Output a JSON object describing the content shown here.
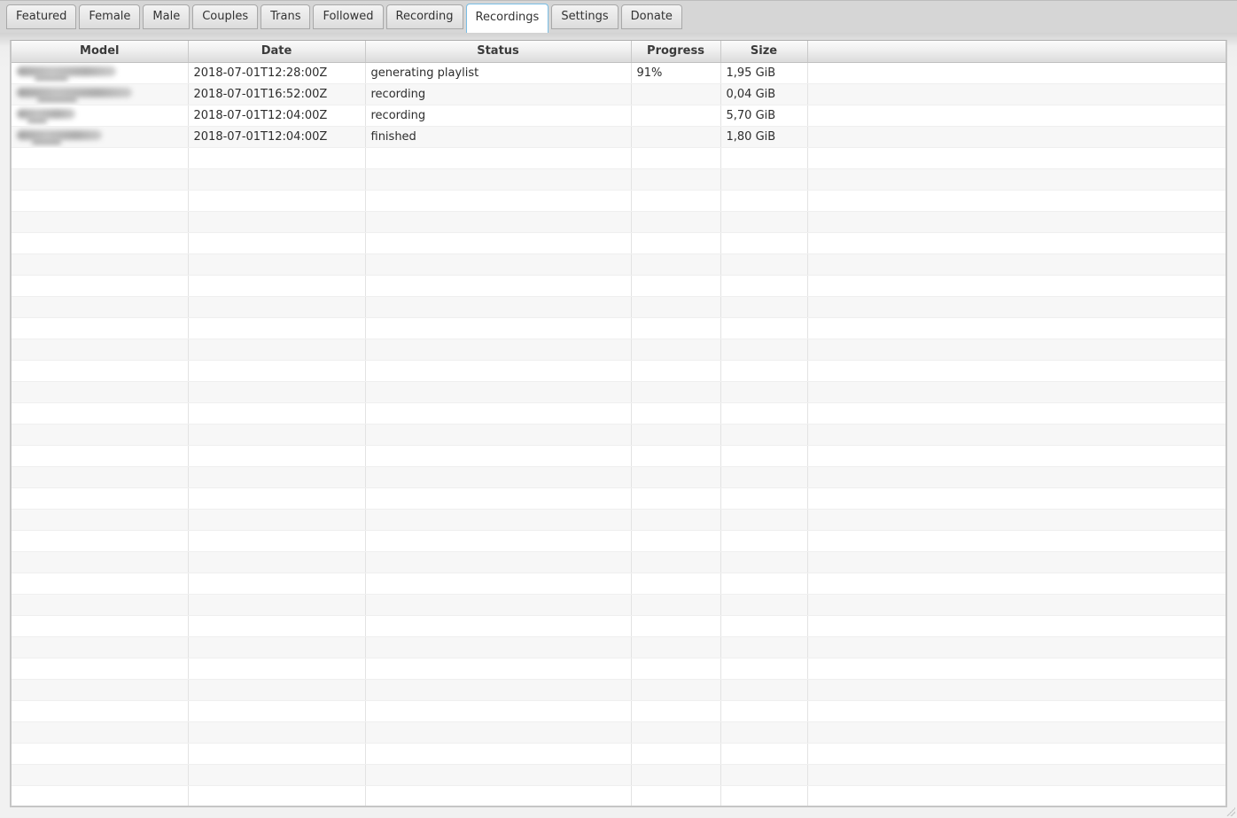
{
  "tabs": [
    {
      "id": "featured",
      "label": "Featured",
      "active": false
    },
    {
      "id": "female",
      "label": "Female",
      "active": false
    },
    {
      "id": "male",
      "label": "Male",
      "active": false
    },
    {
      "id": "couples",
      "label": "Couples",
      "active": false
    },
    {
      "id": "trans",
      "label": "Trans",
      "active": false
    },
    {
      "id": "followed",
      "label": "Followed",
      "active": false
    },
    {
      "id": "recording",
      "label": "Recording",
      "active": false
    },
    {
      "id": "recordings",
      "label": "Recordings",
      "active": true
    },
    {
      "id": "settings",
      "label": "Settings",
      "active": false
    },
    {
      "id": "donate",
      "label": "Donate",
      "active": false
    }
  ],
  "recordings_table": {
    "columns": [
      {
        "id": "model",
        "label": "Model"
      },
      {
        "id": "date",
        "label": "Date"
      },
      {
        "id": "status",
        "label": "Status"
      },
      {
        "id": "progress",
        "label": "Progress"
      },
      {
        "id": "size",
        "label": "Size"
      },
      {
        "id": "filler",
        "label": ""
      }
    ],
    "rows": [
      {
        "model_redacted": true,
        "model_blur_width": 112,
        "date": "2018-07-01T12:28:00Z",
        "status": "generating playlist",
        "progress": "91%",
        "size": "1,95 GiB"
      },
      {
        "model_redacted": true,
        "model_blur_width": 130,
        "date": "2018-07-01T16:52:00Z",
        "status": "recording",
        "progress": "",
        "size": "0,04 GiB"
      },
      {
        "model_redacted": true,
        "model_blur_width": 66,
        "date": "2018-07-01T12:04:00Z",
        "status": "recording",
        "progress": "",
        "size": "5,70 GiB"
      },
      {
        "model_redacted": true,
        "model_blur_width": 96,
        "date": "2018-07-01T12:04:00Z",
        "status": "finished",
        "progress": "",
        "size": "1,80 GiB"
      }
    ],
    "empty_row_count": 31
  },
  "colors": {
    "active_tab_border": "#79bde4",
    "tabbar_background": "#d6d6d6",
    "row_alt_background": "#f7f7f7",
    "header_text": "#3b3b3b"
  }
}
